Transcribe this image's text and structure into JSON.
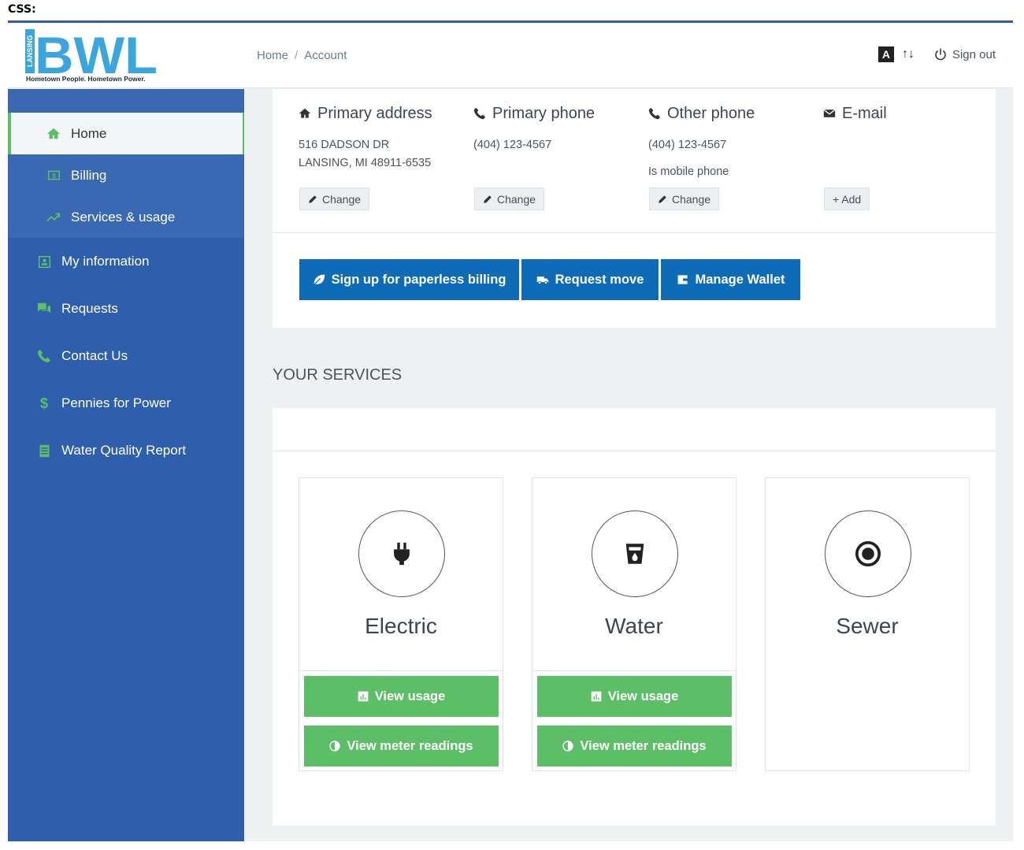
{
  "doc_label": "CSS:",
  "logo": {
    "text": "BWL",
    "vertical_text": "LANSING",
    "tagline": "Hometown People. Hometown Power."
  },
  "breadcrumb": [
    "Home",
    "Account"
  ],
  "header": {
    "font_size_label": "A",
    "sort_icon": "↑↓",
    "signout_label": "Sign out"
  },
  "sidebar": {
    "subitems": [
      {
        "label": "Home",
        "icon": "home-icon"
      },
      {
        "label": "Billing",
        "icon": "billing-icon"
      },
      {
        "label": "Services & usage",
        "icon": "trend-icon"
      }
    ],
    "items": [
      {
        "label": "My information",
        "icon": "id-card-icon"
      },
      {
        "label": "Requests",
        "icon": "chat-icon"
      },
      {
        "label": "Contact Us",
        "icon": "phone-icon"
      },
      {
        "label": "Pennies for Power",
        "icon": "dollar-icon"
      },
      {
        "label": "Water Quality Report",
        "icon": "document-icon"
      }
    ]
  },
  "account": {
    "primary_address": {
      "title": "Primary address",
      "line1": "516 DADSON DR",
      "line2": "LANSING, MI 48911-6535",
      "button": "Change"
    },
    "primary_phone": {
      "title": "Primary phone",
      "value": "(404) 123-4567",
      "button": "Change"
    },
    "other_phone": {
      "title": "Other phone",
      "value": "(404) 123-4567",
      "note": "Is mobile phone",
      "button": "Change"
    },
    "email": {
      "title": "E-mail",
      "button": "+ Add"
    },
    "actions": [
      "Sign up for paperless billing",
      "Request move",
      "Manage Wallet"
    ]
  },
  "services": {
    "heading": "YOUR SERVICES",
    "items": [
      {
        "name": "Electric",
        "icon": "plug-icon",
        "buttons": [
          "View usage",
          "View meter readings"
        ]
      },
      {
        "name": "Water",
        "icon": "water-glass-icon",
        "buttons": [
          "View usage",
          "View meter readings"
        ]
      },
      {
        "name": "Sewer",
        "icon": "target-icon",
        "buttons": []
      }
    ]
  },
  "colors": {
    "sidebar": "#2f5fac",
    "accent_green": "#5cbe67",
    "action_blue": "#0e6bb8"
  }
}
